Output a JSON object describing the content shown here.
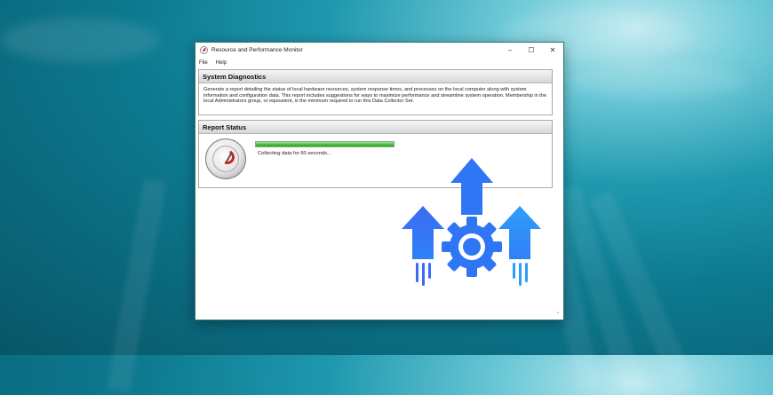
{
  "window": {
    "title": "Resource and Performance Monitor",
    "controls": {
      "minimize": "–",
      "maximize": "☐",
      "close": "✕"
    }
  },
  "menu": [
    "File",
    "Help"
  ],
  "diagnostics": {
    "heading": "System Diagnostics",
    "description": "Generate a report detailing the status of local hardware resources, system response times, and processes on the local computer along with system information and configuration data. This report includes suggestions for ways to maximize performance and streamline system operation. Membership in the local Administrators group, or equivalent, is the minimum required to run this Data Collector Set."
  },
  "report": {
    "heading": "Report Status",
    "status": "Collecting data for 60 seconds...",
    "progress_percent": 100
  },
  "colors": {
    "accent_blue": "#2f76f5",
    "progress_green": "#38c432"
  },
  "icons": [
    "app-monitor-icon",
    "performance-gauge-icon",
    "gear-arrows-icon",
    "chevron-down-icon"
  ]
}
